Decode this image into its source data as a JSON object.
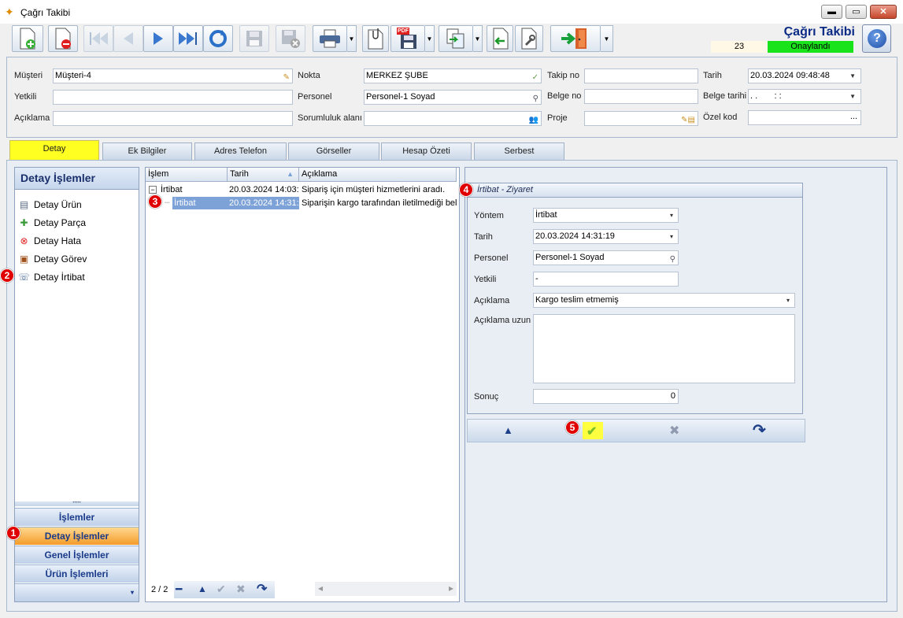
{
  "window": {
    "title": "Çağrı Takibi",
    "minimize": "▬",
    "maximize": "▭",
    "close": "✕"
  },
  "toolbar": {
    "app_title": "Çağrı Takibi",
    "record_count": "23",
    "status": "Onaylandı",
    "status_color": "#19e41b",
    "pdf_label": "PDF",
    "help_label": "?"
  },
  "header": {
    "musteri_label": "Müşteri",
    "musteri_value": "Müşteri-4",
    "yetkili_label": "Yetkili",
    "yetkili_value": "",
    "aciklama_label": "Açıklama",
    "aciklama_value": "",
    "nokta_label": "Nokta",
    "nokta_value": "MERKEZ ŞUBE",
    "personel_label": "Personel",
    "personel_value": "Personel-1 Soyad",
    "sorumluluk_label": "Sorumluluk alanı",
    "sorumluluk_value": "",
    "takipno_label": "Takip no",
    "takipno_value": "",
    "belgeno_label": "Belge no",
    "belgeno_value": "",
    "proje_label": "Proje",
    "proje_value": "",
    "tarih_label": "Tarih",
    "tarih_value": "20.03.2024 09:48:48",
    "belgetarihi_label": "Belge tarihi",
    "belgetarihi_value": ". .       : :",
    "ozelkod_label": "Özel kod",
    "ozelkod_value": "..."
  },
  "tabs": [
    {
      "label": "Detay"
    },
    {
      "label": "Ek Bilgiler"
    },
    {
      "label": "Adres Telefon"
    },
    {
      "label": "Görseller"
    },
    {
      "label": "Hesap Özeti"
    },
    {
      "label": "Serbest"
    }
  ],
  "nav": {
    "header": "Detay İşlemler",
    "items": [
      {
        "label": "Detay Ürün"
      },
      {
        "label": "Detay Parça"
      },
      {
        "label": "Detay Hata"
      },
      {
        "label": "Detay Görev"
      },
      {
        "label": "Detay İrtibat"
      }
    ],
    "grip": "•••••",
    "groups": [
      {
        "label": "İşlemler"
      },
      {
        "label": "Detay İşlemler"
      },
      {
        "label": "Genel İşlemler"
      },
      {
        "label": "Ürün İşlemleri"
      }
    ],
    "more": "▾"
  },
  "grid": {
    "columns": [
      "İşlem",
      "Tarih",
      "Açıklama"
    ],
    "sort_icon": "▲",
    "rows": [
      {
        "islem": "İrtibat",
        "tarih": "20.03.2024 14:03:",
        "aciklama": "Sipariş için müşteri hizmetlerini aradı.",
        "expander": "−"
      },
      {
        "islem": "İrtibat",
        "tarih": "20.03.2024 14:31:",
        "aciklama": "Siparişin kargo tarafından iletilmediği belirti"
      }
    ],
    "pager": "2 / 2",
    "nav_remove": "━",
    "nav_up": "▲",
    "nav_ok": "✔",
    "nav_cancel": "✖",
    "nav_redo": "↷",
    "scroll_left": "◂",
    "scroll_right": "▸"
  },
  "detail": {
    "title": "İrtibat - Ziyaret",
    "yontem_label": "Yöntem",
    "yontem_value": "İrtibat",
    "tarih_label": "Tarih",
    "tarih_value": "20.03.2024 14:31:19",
    "personel_label": "Personel",
    "personel_value": "Personel-1 Soyad",
    "yetkili_label": "Yetkili",
    "yetkili_value": "-",
    "aciklama_label": "Açıklama",
    "aciklama_value": "Kargo teslim etmemiş",
    "aciklama_uzun_label": "Açıklama uzun",
    "aciklama_uzun_value": "",
    "sonuc_label": "Sonuç",
    "sonuc_value": "0",
    "dropdown": "▾"
  },
  "actions": {
    "up": "▲",
    "ok": "✔",
    "cancel": "✖",
    "redo": "↷"
  },
  "markers": [
    "1",
    "2",
    "3",
    "4",
    "5"
  ]
}
